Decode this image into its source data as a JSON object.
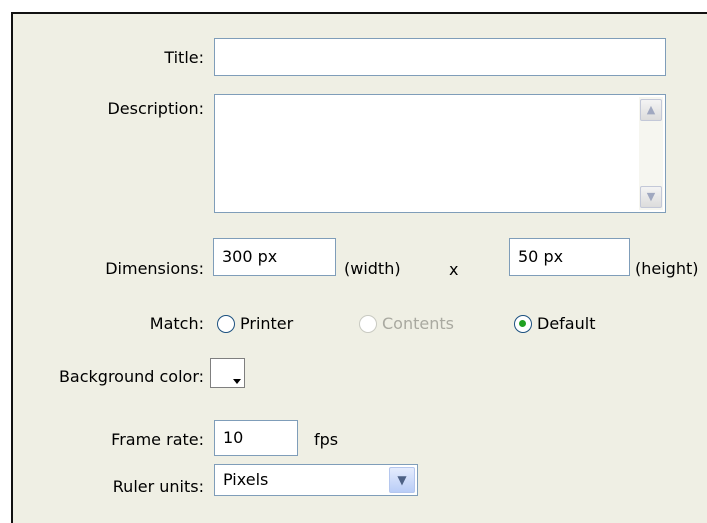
{
  "form": {
    "title": {
      "label": "Title:",
      "value": ""
    },
    "description": {
      "label": "Description:",
      "value": ""
    },
    "dimensions": {
      "label": "Dimensions:",
      "width_value": "300 px",
      "width_unit": "(width)",
      "separator": "x",
      "height_value": "50 px",
      "height_unit": "(height)"
    },
    "match": {
      "label": "Match:",
      "options": [
        {
          "label": "Printer",
          "selected": false,
          "enabled": true
        },
        {
          "label": "Contents",
          "selected": false,
          "enabled": false
        },
        {
          "label": "Default",
          "selected": true,
          "enabled": true
        }
      ]
    },
    "background_color": {
      "label": "Background color:",
      "color": "#ffffff"
    },
    "frame_rate": {
      "label": "Frame rate:",
      "value": "10",
      "unit": "fps"
    },
    "ruler_units": {
      "label": "Ruler units:",
      "value": "Pixels"
    }
  },
  "icons": {
    "scroll_up": "chevron-up-icon",
    "scroll_down": "chevron-down-icon",
    "select_arrow": "chevron-down-icon",
    "swatch_arrow": "dropdown-arrow-icon"
  }
}
